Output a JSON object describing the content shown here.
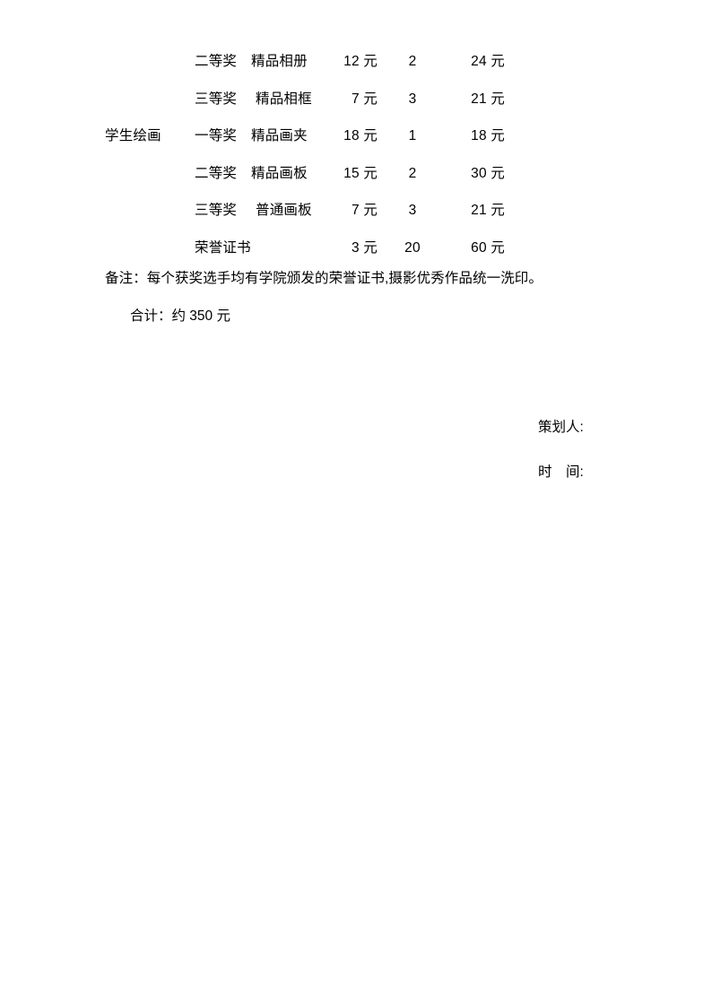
{
  "document": {
    "table": {
      "columns": [
        "category",
        "prize_level",
        "item",
        "unit_price",
        "quantity",
        "subtotal"
      ],
      "rows": [
        {
          "category": "",
          "prize_level": "二等奖",
          "item": "精品相册",
          "unit_price": "12 元",
          "quantity": "2",
          "subtotal": "24 元"
        },
        {
          "category": "",
          "prize_level": "三等奖",
          "item": "精品相框",
          "unit_price": "7 元",
          "quantity": "3",
          "subtotal": "21 元"
        },
        {
          "category": "学生绘画",
          "prize_level": "一等奖",
          "item": "精品画夹",
          "unit_price": "18 元",
          "quantity": "1",
          "subtotal": "18 元"
        },
        {
          "category": "",
          "prize_level": "二等奖",
          "item": "精品画板",
          "unit_price": "15 元",
          "quantity": "2",
          "subtotal": "30 元"
        },
        {
          "category": "",
          "prize_level": "三等奖",
          "item": "普通画板",
          "unit_price": "7 元",
          "quantity": "3",
          "subtotal": "21 元"
        },
        {
          "category": "",
          "prize_level": "荣誉证书",
          "item": "",
          "unit_price": "3 元",
          "quantity": "20",
          "subtotal": "60 元"
        }
      ]
    },
    "note": "备注：每个获奖选手均有学院颁发的荣誉证书,摄影优秀作品统一洗印。",
    "total": "合计：约 350 元",
    "signature": {
      "planner_label": "策划人:",
      "date_label": "时　间:"
    },
    "colors": {
      "page_background": "#ffffff",
      "text": "#000000"
    }
  }
}
